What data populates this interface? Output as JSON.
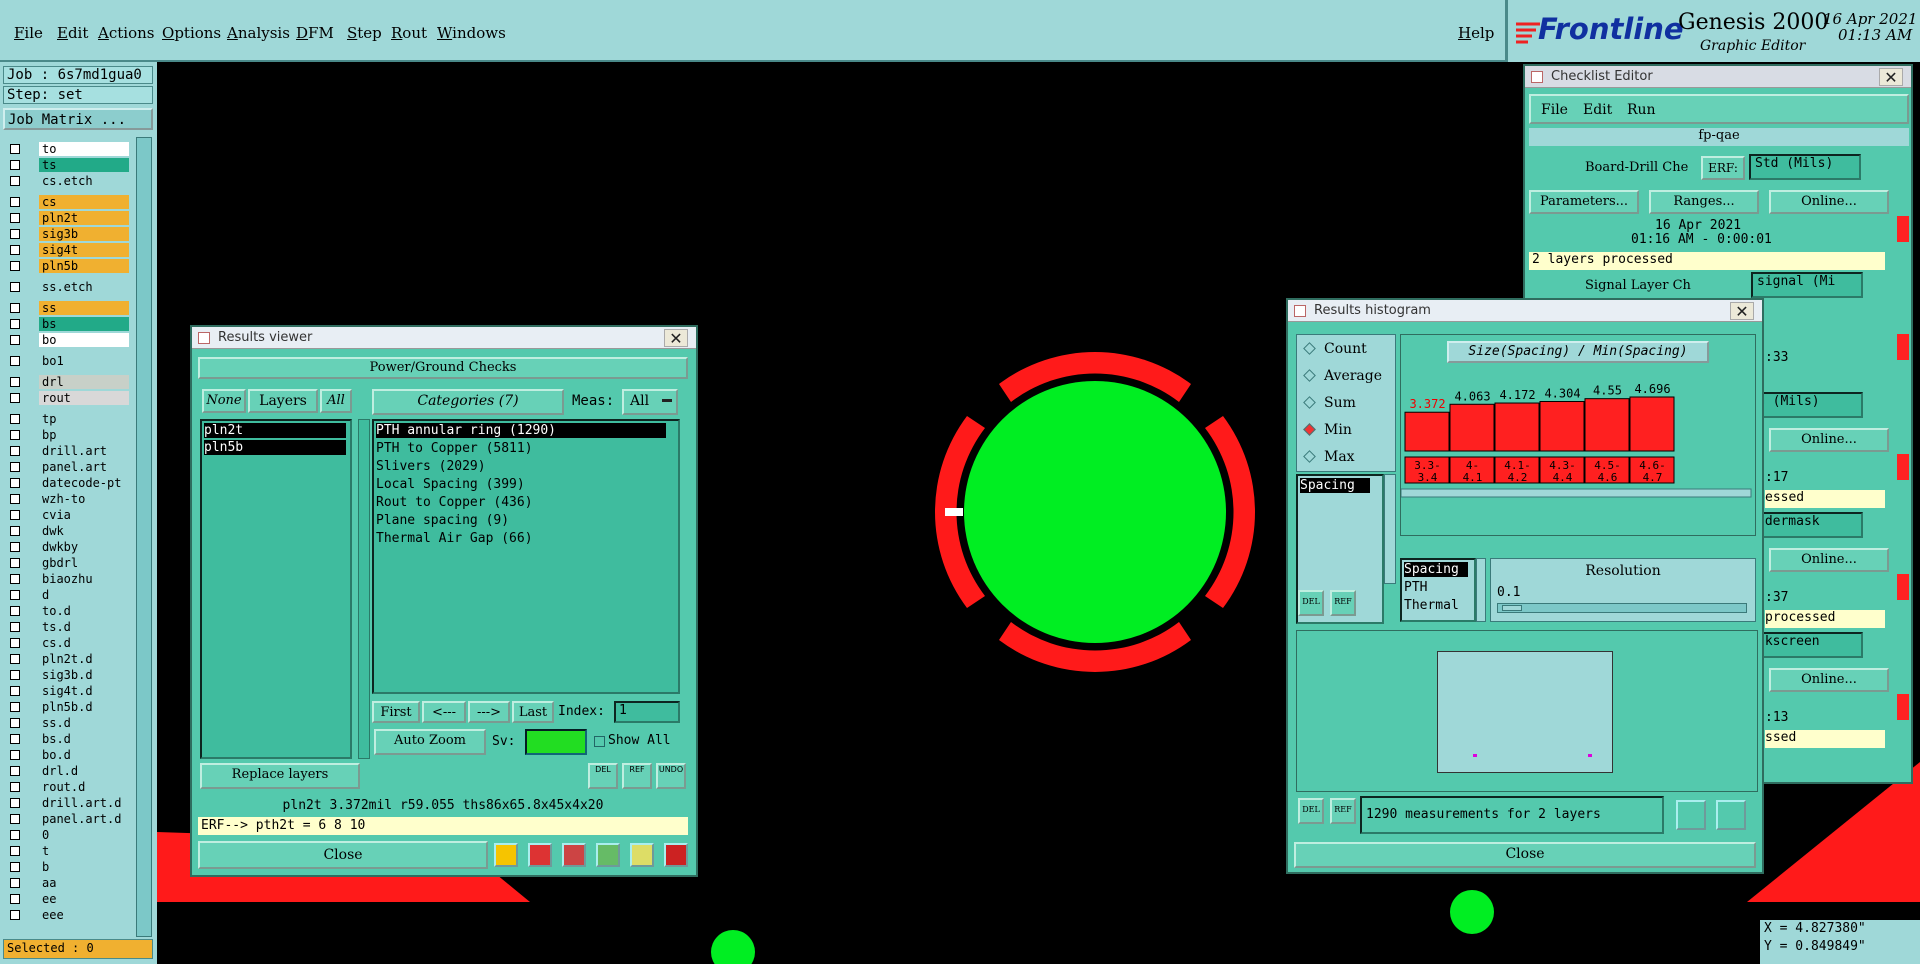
{
  "menu": {
    "items": [
      "File",
      "Edit",
      "Actions",
      "Options",
      "Analysis",
      "DFM",
      "Step",
      "Rout",
      "Windows"
    ],
    "help": "Help"
  },
  "brand": {
    "logo": "Frontline",
    "product": "Genesis 2000",
    "subtitle": "Graphic Editor",
    "date": "16 Apr 2021",
    "time": "01:13 AM"
  },
  "left": {
    "job": "Job : 6s7md1gua0",
    "step": "Step: set",
    "job_matrix": "Job Matrix ...",
    "selected": "Selected : 0",
    "layers": [
      {
        "name": "to",
        "color": "#ffffff"
      },
      {
        "name": "ts",
        "color": "#22aa88"
      },
      {
        "name": "cs.etch",
        "color": "#9fd8d8"
      },
      {
        "name": "cs",
        "color": "#f0b030"
      },
      {
        "name": "pln2t",
        "color": "#f0b030"
      },
      {
        "name": "sig3b",
        "color": "#f0b030"
      },
      {
        "name": "sig4t",
        "color": "#f0b030"
      },
      {
        "name": "pln5b",
        "color": "#f0b030"
      },
      {
        "name": "ss.etch",
        "color": "#9fd8d8"
      },
      {
        "name": "ss",
        "color": "#f0b030"
      },
      {
        "name": "bs",
        "color": "#22aa88"
      },
      {
        "name": "bo",
        "color": "#ffffff"
      },
      {
        "name": "bo1",
        "color": "#9fd8d8"
      },
      {
        "name": "drl",
        "color": "#c8d0c8"
      },
      {
        "name": "rout",
        "color": "#d8d8d8"
      },
      {
        "name": "tp",
        "color": "#9fd8d8"
      },
      {
        "name": "bp",
        "color": "#9fd8d8"
      },
      {
        "name": "drill.art",
        "color": "#9fd8d8"
      },
      {
        "name": "panel.art",
        "color": "#9fd8d8"
      },
      {
        "name": "datecode-pt",
        "color": "#9fd8d8"
      },
      {
        "name": "wzh-to",
        "color": "#9fd8d8"
      },
      {
        "name": "cvia",
        "color": "#9fd8d8"
      },
      {
        "name": "dwk",
        "color": "#9fd8d8"
      },
      {
        "name": "dwkby",
        "color": "#9fd8d8"
      },
      {
        "name": "gbdrl",
        "color": "#9fd8d8"
      },
      {
        "name": "biaozhu",
        "color": "#9fd8d8"
      },
      {
        "name": "d",
        "color": "#9fd8d8"
      },
      {
        "name": "to.d",
        "color": "#9fd8d8"
      },
      {
        "name": "ts.d",
        "color": "#9fd8d8"
      },
      {
        "name": "cs.d",
        "color": "#9fd8d8"
      },
      {
        "name": "pln2t.d",
        "color": "#9fd8d8"
      },
      {
        "name": "sig3b.d",
        "color": "#9fd8d8"
      },
      {
        "name": "sig4t.d",
        "color": "#9fd8d8"
      },
      {
        "name": "pln5b.d",
        "color": "#9fd8d8"
      },
      {
        "name": "ss.d",
        "color": "#9fd8d8"
      },
      {
        "name": "bs.d",
        "color": "#9fd8d8"
      },
      {
        "name": "bo.d",
        "color": "#9fd8d8"
      },
      {
        "name": "drl.d",
        "color": "#9fd8d8"
      },
      {
        "name": "rout.d",
        "color": "#9fd8d8"
      },
      {
        "name": "drill.art.d",
        "color": "#9fd8d8"
      },
      {
        "name": "panel.art.d",
        "color": "#9fd8d8"
      },
      {
        "name": "0",
        "color": "#9fd8d8"
      },
      {
        "name": "t",
        "color": "#9fd8d8"
      },
      {
        "name": "b",
        "color": "#9fd8d8"
      },
      {
        "name": "aa",
        "color": "#9fd8d8"
      },
      {
        "name": "ee",
        "color": "#9fd8d8"
      },
      {
        "name": "eee",
        "color": "#9fd8d8"
      }
    ]
  },
  "results_viewer": {
    "title": "Results viewer",
    "section": "Power/Ground Checks",
    "none_btn": "None",
    "layers_btn": "Layers",
    "all_btn": "All",
    "categories_btn": "Categories (7)",
    "meas_label": "Meas:",
    "meas_value": "All",
    "layer_list": [
      "pln2t",
      "pln5b"
    ],
    "categories": [
      "PTH annular ring (1290)",
      "PTH to Copper (5811)",
      "Slivers (2029)",
      "Local Spacing (399)",
      "Rout to Copper (436)",
      "Plane spacing (9)",
      "Thermal Air Gap (66)"
    ],
    "first": "First",
    "prev": "<---",
    "next": "--->",
    "last": "Last",
    "index_label": "Index:",
    "index_value": "1",
    "auto_zoom": "Auto Zoom",
    "sv_label": "Sv:",
    "show_all": "Show All",
    "replace_layers": "Replace layers",
    "status": "pln2t 3.372mil  r59.055  ths86x65.8x45x4x20",
    "erf": "ERF--> pth2t = 6 8 10",
    "close": "Close",
    "del": "DEL",
    "ref": "REF",
    "undo": "UNDO"
  },
  "histogram": {
    "title": "Results histogram",
    "modes": [
      "Count",
      "Average",
      "Sum",
      "Min",
      "Max"
    ],
    "selected_mode": "Min",
    "meas_list": [
      "Spacing"
    ],
    "chart_title": "Size(Spacing) / Min(Spacing)",
    "bars": [
      {
        "value": "3.372",
        "range": "3.3-\n3.4"
      },
      {
        "value": "4.063",
        "range": "4-\n4.1"
      },
      {
        "value": "4.172",
        "range": "4.1-\n4.2"
      },
      {
        "value": "4.304",
        "range": "4.3-\n4.4"
      },
      {
        "value": "4.55",
        "range": "4.5-\n4.6"
      },
      {
        "value": "4.696",
        "range": "4.6-\n4.7"
      }
    ],
    "attr_list": [
      "Spacing",
      "PTH",
      "Thermal"
    ],
    "resolution_label": "Resolution",
    "resolution_value": "0.1",
    "measurements": "1290 measurements for 2 layers",
    "close": "Close",
    "del": "DEL",
    "ref": "REF"
  },
  "checklist": {
    "title": "Checklist Editor",
    "menu": [
      "File",
      "Edit",
      "Run"
    ],
    "name": "fp-qae",
    "row1_title": "Board-Drill Che",
    "erf": "ERF:",
    "erf_val1": "Std (Mils)",
    "params": "Parameters...",
    "ranges": "Ranges...",
    "online": "Online...",
    "date1": "16 Apr 2021",
    "time1": "01:16 AM - 0:00:01",
    "processed1": "2 layers processed",
    "row2_title": "Signal Layer Ch",
    "erf_val2": "signal (Mi",
    "t2": ":33",
    "erf_val3": "G (Mils)",
    "t3": ":17",
    "p3": "essed",
    "erf_val4": "ldermask",
    "t4": ":37",
    "p4": "processed",
    "erf_val5": "lkscreen",
    "t5": ":13",
    "p5": "ssed"
  },
  "coords": {
    "x": "X = 4.827380\"",
    "y": "Y = 0.849849\""
  },
  "colors": {
    "panel": "#9fd8d8",
    "dialog": "#54c9ad",
    "pad_green": "#00ee22",
    "ring_red": "#ff1a1a"
  }
}
